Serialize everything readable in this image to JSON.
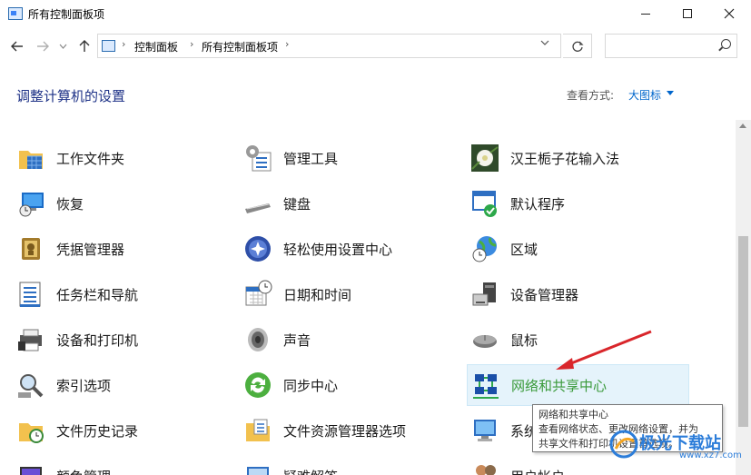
{
  "window": {
    "title": "所有控制面板项",
    "minimize_icon": "minimize-icon",
    "maximize_icon": "maximize-icon",
    "close_icon": "close-icon"
  },
  "nav": {
    "breadcrumbs": [
      "控制面板",
      "所有控制面板项"
    ],
    "search_placeholder": ""
  },
  "header": {
    "title": "调整计算机的设置",
    "view_by_label": "查看方式:",
    "view_by_value": "大图标"
  },
  "items": {
    "col1": [
      "工作文件夹",
      "恢复",
      "凭据管理器",
      "任务栏和导航",
      "设备和打印机",
      "索引选项",
      "文件历史记录",
      "颜色管理"
    ],
    "col2": [
      "管理工具",
      "键盘",
      "轻松使用设置中心",
      "日期和时间",
      "声音",
      "同步中心",
      "文件资源管理器选项",
      "疑难解答"
    ],
    "col3": [
      "汉王栀子花输入法",
      "默认程序",
      "区域",
      "设备管理器",
      "鼠标",
      "网络和共享中心",
      "系统",
      "用户帐户"
    ]
  },
  "tooltip": {
    "title": "网络和共享中心",
    "line1": "查看网络状态、更改网络设置，并为",
    "line2": "共享文件和打印机设置首选项。"
  },
  "watermark": {
    "text": "极光下载站",
    "sub": "www.xz7.com"
  },
  "colors": {
    "title_blue": "#1e3287",
    "link_blue": "#0066cc",
    "highlight_bg": "#e5f3fb",
    "arrow_red": "#d9262b"
  }
}
